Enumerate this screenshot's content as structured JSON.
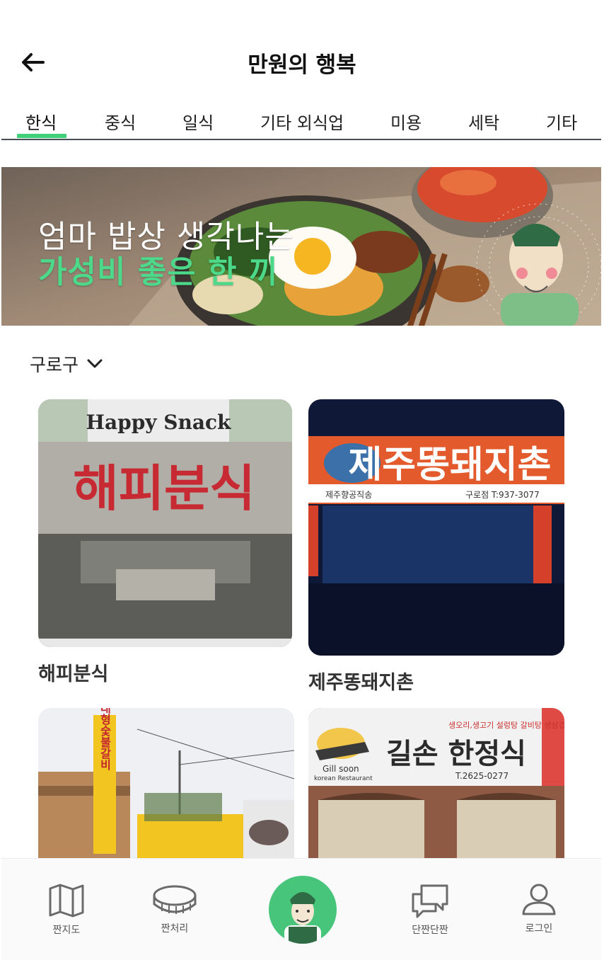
{
  "header": {
    "title": "만원의 행복"
  },
  "tabs": [
    {
      "label": "한식",
      "active": true
    },
    {
      "label": "중식"
    },
    {
      "label": "일식"
    },
    {
      "label": "기타 외식업"
    },
    {
      "label": "미용"
    },
    {
      "label": "세탁"
    },
    {
      "label": "기타"
    }
  ],
  "banner": {
    "line1": "엄마 밥상 생각나는",
    "line2": "가성비 좋은 한 끼"
  },
  "district": {
    "selected": "구로구"
  },
  "stores": [
    {
      "name": "해피분식",
      "sign_text": "해피분식",
      "sign_header": "Happy Snack"
    },
    {
      "name": "제주똥돼지촌",
      "sign_text": "제주똥돼지촌",
      "sign_sub": "제주향공직송",
      "sign_phone": "구로점 T:937-3077"
    },
    {
      "name": "",
      "sign_text": "대형숯불갈비"
    },
    {
      "name": "",
      "sign_text": "길손 한정식",
      "sign_brand": "Gill soon",
      "sign_brand_sub": "korean Restaurant",
      "sign_menu": "생오리,생고기 설렁탕 갈비탕 생삼겹",
      "sign_phone": "T.2625-0277"
    }
  ],
  "bottom_nav": [
    {
      "label": "짠지도",
      "icon": "map-icon"
    },
    {
      "label": "짠처리",
      "icon": "coin-icon"
    },
    {
      "label": "",
      "icon": "mascot-icon"
    },
    {
      "label": "단짠단짠",
      "icon": "chat-icon"
    },
    {
      "label": "로그인",
      "icon": "user-icon"
    }
  ],
  "colors": {
    "accent": "#41d07a",
    "banner_highlight": "#4cd98a",
    "text": "#222222"
  }
}
